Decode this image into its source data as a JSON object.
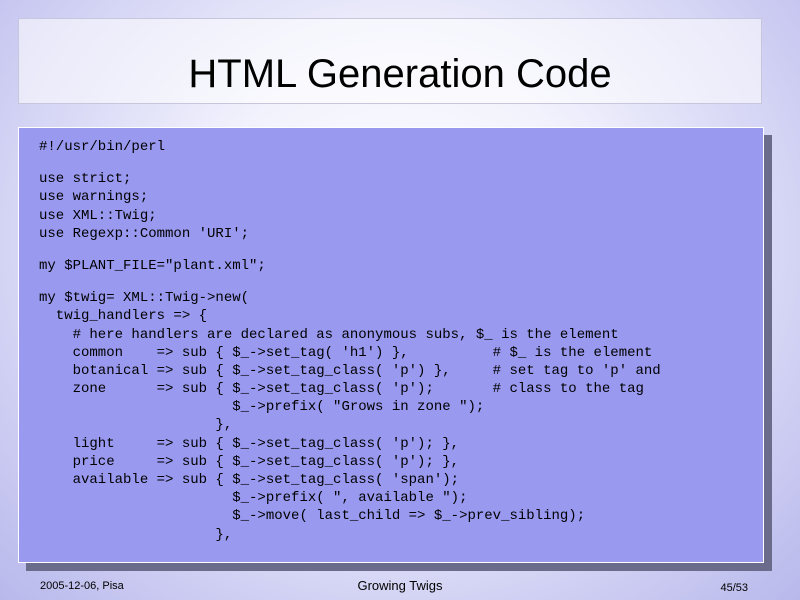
{
  "slide": {
    "title": "HTML Generation Code"
  },
  "code": {
    "groups": [
      [
        "#!/usr/bin/perl"
      ],
      [
        "use strict;",
        "use warnings;",
        "use XML::Twig;",
        "use Regexp::Common 'URI';"
      ],
      [
        "my $PLANT_FILE=\"plant.xml\";"
      ],
      [
        "my $twig= XML::Twig->new(",
        "  twig_handlers => {",
        "    # here handlers are declared as anonymous subs, $_ is the element",
        "    common    => sub { $_->set_tag( 'h1') },          # $_ is the element",
        "    botanical => sub { $_->set_tag_class( 'p') },     # set tag to 'p' and",
        "    zone      => sub { $_->set_tag_class( 'p');       # class to the tag",
        "                       $_->prefix( \"Grows in zone \");",
        "                     },",
        "    light     => sub { $_->set_tag_class( 'p'); },",
        "    price     => sub { $_->set_tag_class( 'p'); },",
        "    available => sub { $_->set_tag_class( 'span');",
        "                       $_->prefix( \", available \");",
        "                       $_->move( last_child => $_->prev_sibling);",
        "                     },"
      ]
    ]
  },
  "footer": {
    "date_location": "2005-12-06, Pisa",
    "talk_title": "Growing Twigs",
    "page": "45/53"
  }
}
